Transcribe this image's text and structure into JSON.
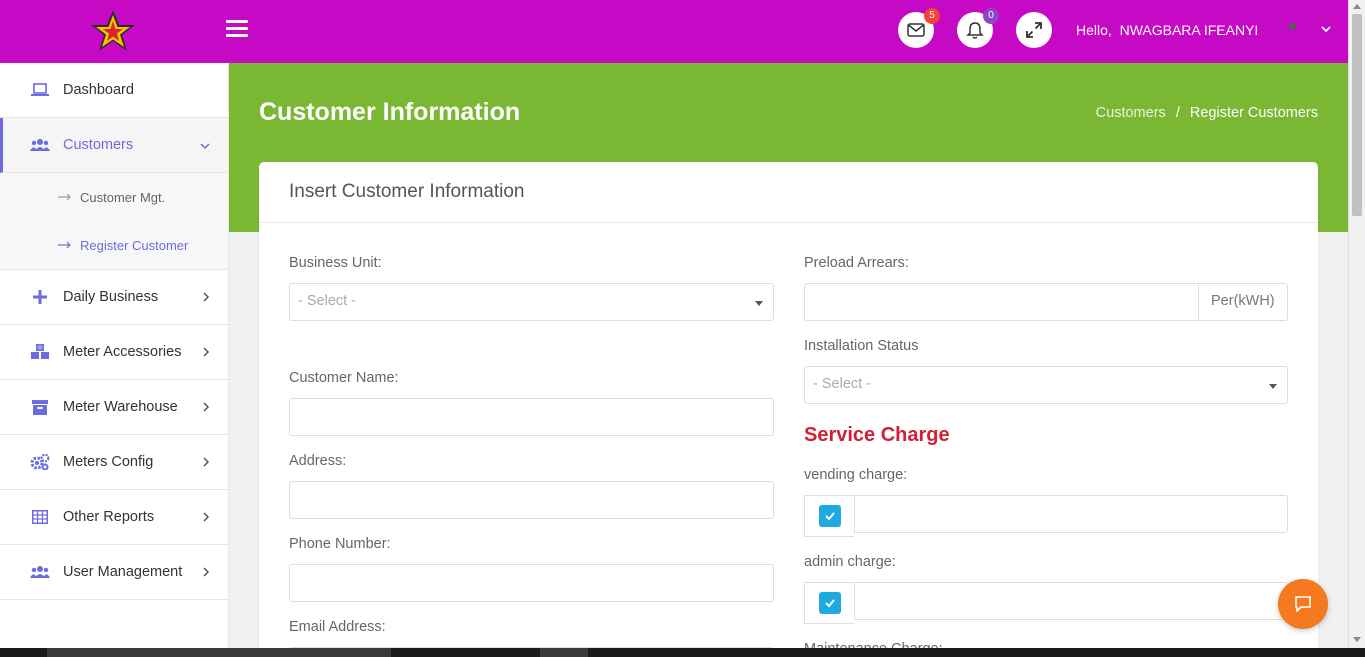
{
  "header": {
    "mail_count": "5",
    "notification_count": "0",
    "greeting": "Hello,",
    "user_name": "NWAGBARA IFEANYI",
    "colors": {
      "topbar": "#c509c5",
      "accent": "#6c6ce0"
    }
  },
  "sidebar": {
    "items": [
      {
        "label": "Dashboard",
        "icon": "laptop-icon"
      },
      {
        "label": "Customers",
        "icon": "users-icon"
      },
      {
        "label": "Daily Business",
        "icon": "plus-icon"
      },
      {
        "label": "Meter Accessories",
        "icon": "cubes-icon"
      },
      {
        "label": "Meter Warehouse",
        "icon": "archive-icon"
      },
      {
        "label": "Meters Config",
        "icon": "gears-icon"
      },
      {
        "label": "Other Reports",
        "icon": "table-icon"
      },
      {
        "label": "User Management",
        "icon": "users-icon"
      }
    ],
    "customers_submenu": [
      {
        "label": "Customer Mgt."
      },
      {
        "label": "Register Customer"
      }
    ]
  },
  "page": {
    "title": "Customer Information",
    "breadcrumb": {
      "parent": "Customers",
      "separator": "/",
      "current": "Register Customers"
    },
    "banner_color": "#7ab733"
  },
  "form": {
    "card_title": "Insert Customer Information",
    "business_unit": {
      "label": "Business Unit:",
      "selected": "- Select -"
    },
    "customer_name": {
      "label": "Customer Name:",
      "value": ""
    },
    "address": {
      "label": "Address:",
      "value": ""
    },
    "phone_number": {
      "label": "Phone Number:",
      "value": ""
    },
    "email_address": {
      "label": "Email Address:",
      "value": ""
    },
    "preload_arrears": {
      "label": "Preload Arrears:",
      "value": "",
      "addon": "Per(kWH)"
    },
    "installation_status": {
      "label": "Installation Status",
      "selected": "- Select -"
    },
    "service_charge": {
      "title": "Service Charge",
      "vending_charge": {
        "label": "vending charge:",
        "checked": true,
        "value": ""
      },
      "admin_charge": {
        "label": "admin charge:",
        "checked": true,
        "value": ""
      },
      "maintenance_charge": {
        "label": "Maintenance Charge:"
      }
    }
  }
}
